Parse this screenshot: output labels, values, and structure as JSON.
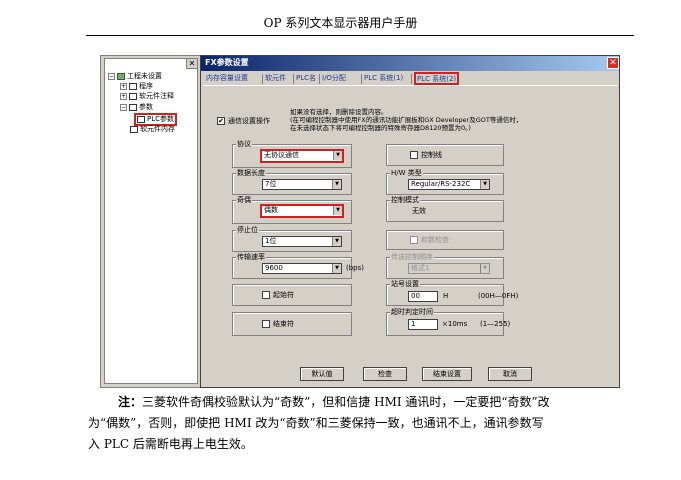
{
  "page_header": "OP 系列文本显示器用户手册",
  "tree": {
    "root": "工程未设置",
    "items": [
      "程序",
      "软元件注释",
      "参数",
      "PLC参数",
      "软元件内存"
    ]
  },
  "dialog": {
    "title": "FX参数设置",
    "tabs": [
      "内存容量设置",
      "软元件",
      "PLC名",
      "I/O分配",
      "PLC 系统(1)",
      "PLC 系统(2)"
    ],
    "comm_checkbox_label": "通信设置操作",
    "comm_checkbox_checked": "✔",
    "note_lines": [
      "如果没有选择，则删除设置内容。",
      "(在可编程控制器中使用FX的通讯功能扩展板和GX Developer及GOT等通信时，",
      "在未选择状态下将可编程控制器的特殊寄存器D8120预置为0。)"
    ],
    "protocol": {
      "label": "协议",
      "value": "无协议通信"
    },
    "data_length": {
      "label": "数据长度",
      "value": "7位"
    },
    "parity": {
      "label": "奇偶",
      "value": "偶数"
    },
    "stop_bit": {
      "label": "停止位",
      "value": "1位"
    },
    "baud": {
      "label": "传输速率",
      "value": "9600",
      "unit": "(bps)"
    },
    "header_cb": "起始符",
    "terminator_cb": "结束符",
    "control_line_cb": "控制线",
    "hw_type": {
      "label": "H/W 类型",
      "value": "Regular/RS-232C"
    },
    "control_mode": {
      "label": "控制模式",
      "value": "无效"
    },
    "sum_check_cb": "和数检查",
    "transfer_control": {
      "label": "传送控制顺序",
      "value": "格式1"
    },
    "station": {
      "label": "站号设置",
      "value": "00",
      "suffix": "H",
      "range": "(00H—0FH)"
    },
    "timeout": {
      "label": "超时判定时间",
      "value": "1",
      "suffix": "×10ms",
      "range": "(1—255)"
    },
    "buttons": [
      "默认值",
      "检查",
      "结束设置",
      "取消"
    ]
  },
  "note": {
    "bold_prefix": "注：",
    "line1": "三菱软件奇偶校验默认为“奇数”，但和信捷 HMI 通讯时，一定要把“奇数”改",
    "line2": "为“偶数”，否则，即使把 HMI 改为“奇数”和三菱保持一致，也通讯不上，通讯参数写",
    "line3": "入 PLC 后需断电再上电生效。"
  }
}
